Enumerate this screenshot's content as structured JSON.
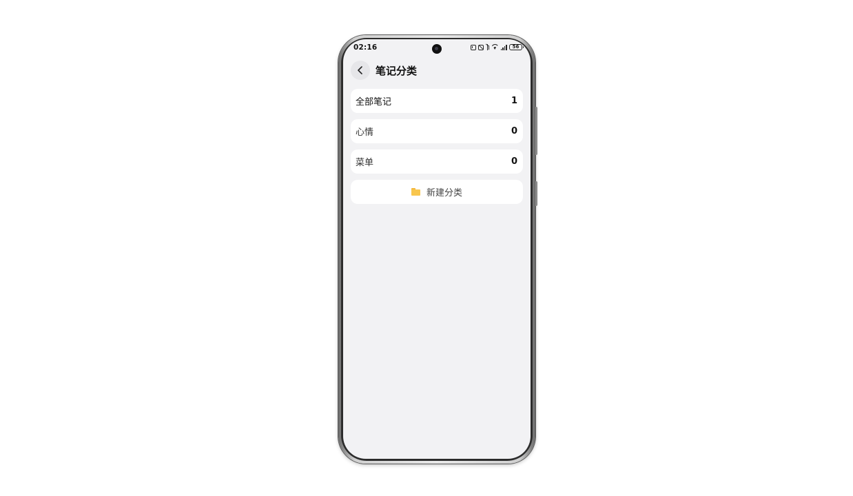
{
  "status_bar": {
    "time": "02:16",
    "battery": "56",
    "icons": [
      "nfc-icon",
      "mute-icon",
      "bluetooth-icon",
      "wifi-icon",
      "signal-icon",
      "battery-icon"
    ]
  },
  "header": {
    "back_icon": "chevron-left-icon",
    "title": "笔记分类"
  },
  "categories": [
    {
      "name": "全部笔记",
      "count": "1"
    },
    {
      "name": "心情",
      "count": "0"
    },
    {
      "name": "菜单",
      "count": "0"
    }
  ],
  "new_category": {
    "icon": "folder-icon",
    "label": "新建分类",
    "icon_color": "#f8c64e"
  },
  "colors": {
    "screen_background": "#f2f2f4",
    "card_background": "#ffffff"
  }
}
